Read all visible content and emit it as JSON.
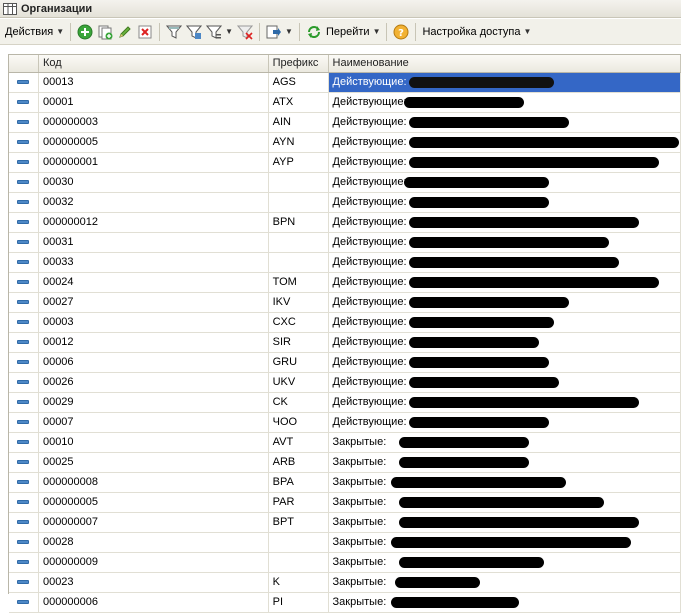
{
  "window": {
    "title": "Организации"
  },
  "toolbar": {
    "actions_label": "Действия",
    "goto_label": "Перейти",
    "access_label": "Настройка доступа",
    "icons": [
      "add-icon",
      "copy-icon",
      "edit-icon",
      "delete-icon",
      "filter-icon",
      "filter-by-value-icon",
      "filter-list-icon",
      "cancel-filter-icon",
      "move-icon",
      "refresh-icon",
      "help-icon"
    ]
  },
  "colors": {
    "selection": "#3467c6",
    "toolbar_bg": "#f2f1ea",
    "row_marker": "#4d88c6"
  },
  "table": {
    "columns": [
      "Код",
      "Префикс",
      "Наименование"
    ],
    "rows": [
      {
        "code": "00013",
        "prefix": "AGS",
        "name": "Действующие: ",
        "redact": [
          80,
          145
        ],
        "selected": true
      },
      {
        "code": "00001",
        "prefix": "ATX",
        "name": "Действующие:",
        "redact": [
          75,
          120
        ]
      },
      {
        "code": "000000003",
        "prefix": "AIN",
        "name": "Действующие: ",
        "redact": [
          80,
          160
        ]
      },
      {
        "code": "000000005",
        "prefix": "AYN",
        "name": "Действующие: ",
        "redact": [
          80,
          275
        ]
      },
      {
        "code": "000000001",
        "prefix": "AYP",
        "name": "Действующие: ",
        "redact": [
          80,
          250
        ]
      },
      {
        "code": "00030",
        "prefix": "",
        "name": "Действующие:",
        "redact": [
          75,
          145
        ]
      },
      {
        "code": "00032",
        "prefix": "",
        "name": "Действующие: ",
        "redact": [
          80,
          140
        ]
      },
      {
        "code": "000000012",
        "prefix": "BPN",
        "name": "Действующие: ",
        "redact": [
          80,
          230
        ]
      },
      {
        "code": "00031",
        "prefix": "",
        "name": "Действующие: ",
        "redact": [
          80,
          200
        ]
      },
      {
        "code": "00033",
        "prefix": "",
        "name": "Действующие: ",
        "redact": [
          80,
          210
        ]
      },
      {
        "code": "00024",
        "prefix": "TOM",
        "name": "Действующие: ",
        "redact": [
          80,
          250
        ]
      },
      {
        "code": "00027",
        "prefix": "IKV",
        "name": "Действующие: ",
        "redact": [
          80,
          160
        ]
      },
      {
        "code": "00003",
        "prefix": "CXC",
        "name": "Действующие: ",
        "redact": [
          80,
          145
        ]
      },
      {
        "code": "00012",
        "prefix": "SIR",
        "name": "Действующие: ",
        "redact": [
          80,
          130
        ]
      },
      {
        "code": "00006",
        "prefix": "GRU",
        "name": "Действующие: ",
        "redact": [
          80,
          140
        ]
      },
      {
        "code": "00026",
        "prefix": "UKV",
        "name": "Действующие: ",
        "redact": [
          80,
          150
        ]
      },
      {
        "code": "00029",
        "prefix": "CK",
        "name": "Действующие: ",
        "redact": [
          80,
          230
        ]
      },
      {
        "code": "00007",
        "prefix": "ЧОО",
        "name": "Действующие: ",
        "redact": [
          80,
          140
        ]
      },
      {
        "code": "00010",
        "prefix": "AVT",
        "name": "Закрытые: ",
        "redact": [
          70,
          130
        ]
      },
      {
        "code": "00025",
        "prefix": "ARB",
        "name": "Закрытые: ",
        "redact": [
          70,
          130
        ]
      },
      {
        "code": "000000008",
        "prefix": "BPA",
        "name": "Закрытые:",
        "redact": [
          62,
          175
        ]
      },
      {
        "code": "000000005",
        "prefix": "PAR",
        "name": "Закрытые: ",
        "redact": [
          70,
          205
        ]
      },
      {
        "code": "000000007",
        "prefix": "BPT",
        "name": "Закрытые: ",
        "redact": [
          70,
          240
        ]
      },
      {
        "code": "00028",
        "prefix": "",
        "name": "Закрытые:",
        "redact": [
          62,
          240
        ]
      },
      {
        "code": "000000009",
        "prefix": "",
        "name": "Закрытые: ",
        "redact": [
          70,
          145
        ]
      },
      {
        "code": "00023",
        "prefix": "K",
        "name": "Закрытые: ",
        "redact": [
          66,
          85
        ]
      },
      {
        "code": "000000006",
        "prefix": "PI",
        "name": "Закрытые:",
        "redact": [
          62,
          128
        ]
      }
    ]
  }
}
